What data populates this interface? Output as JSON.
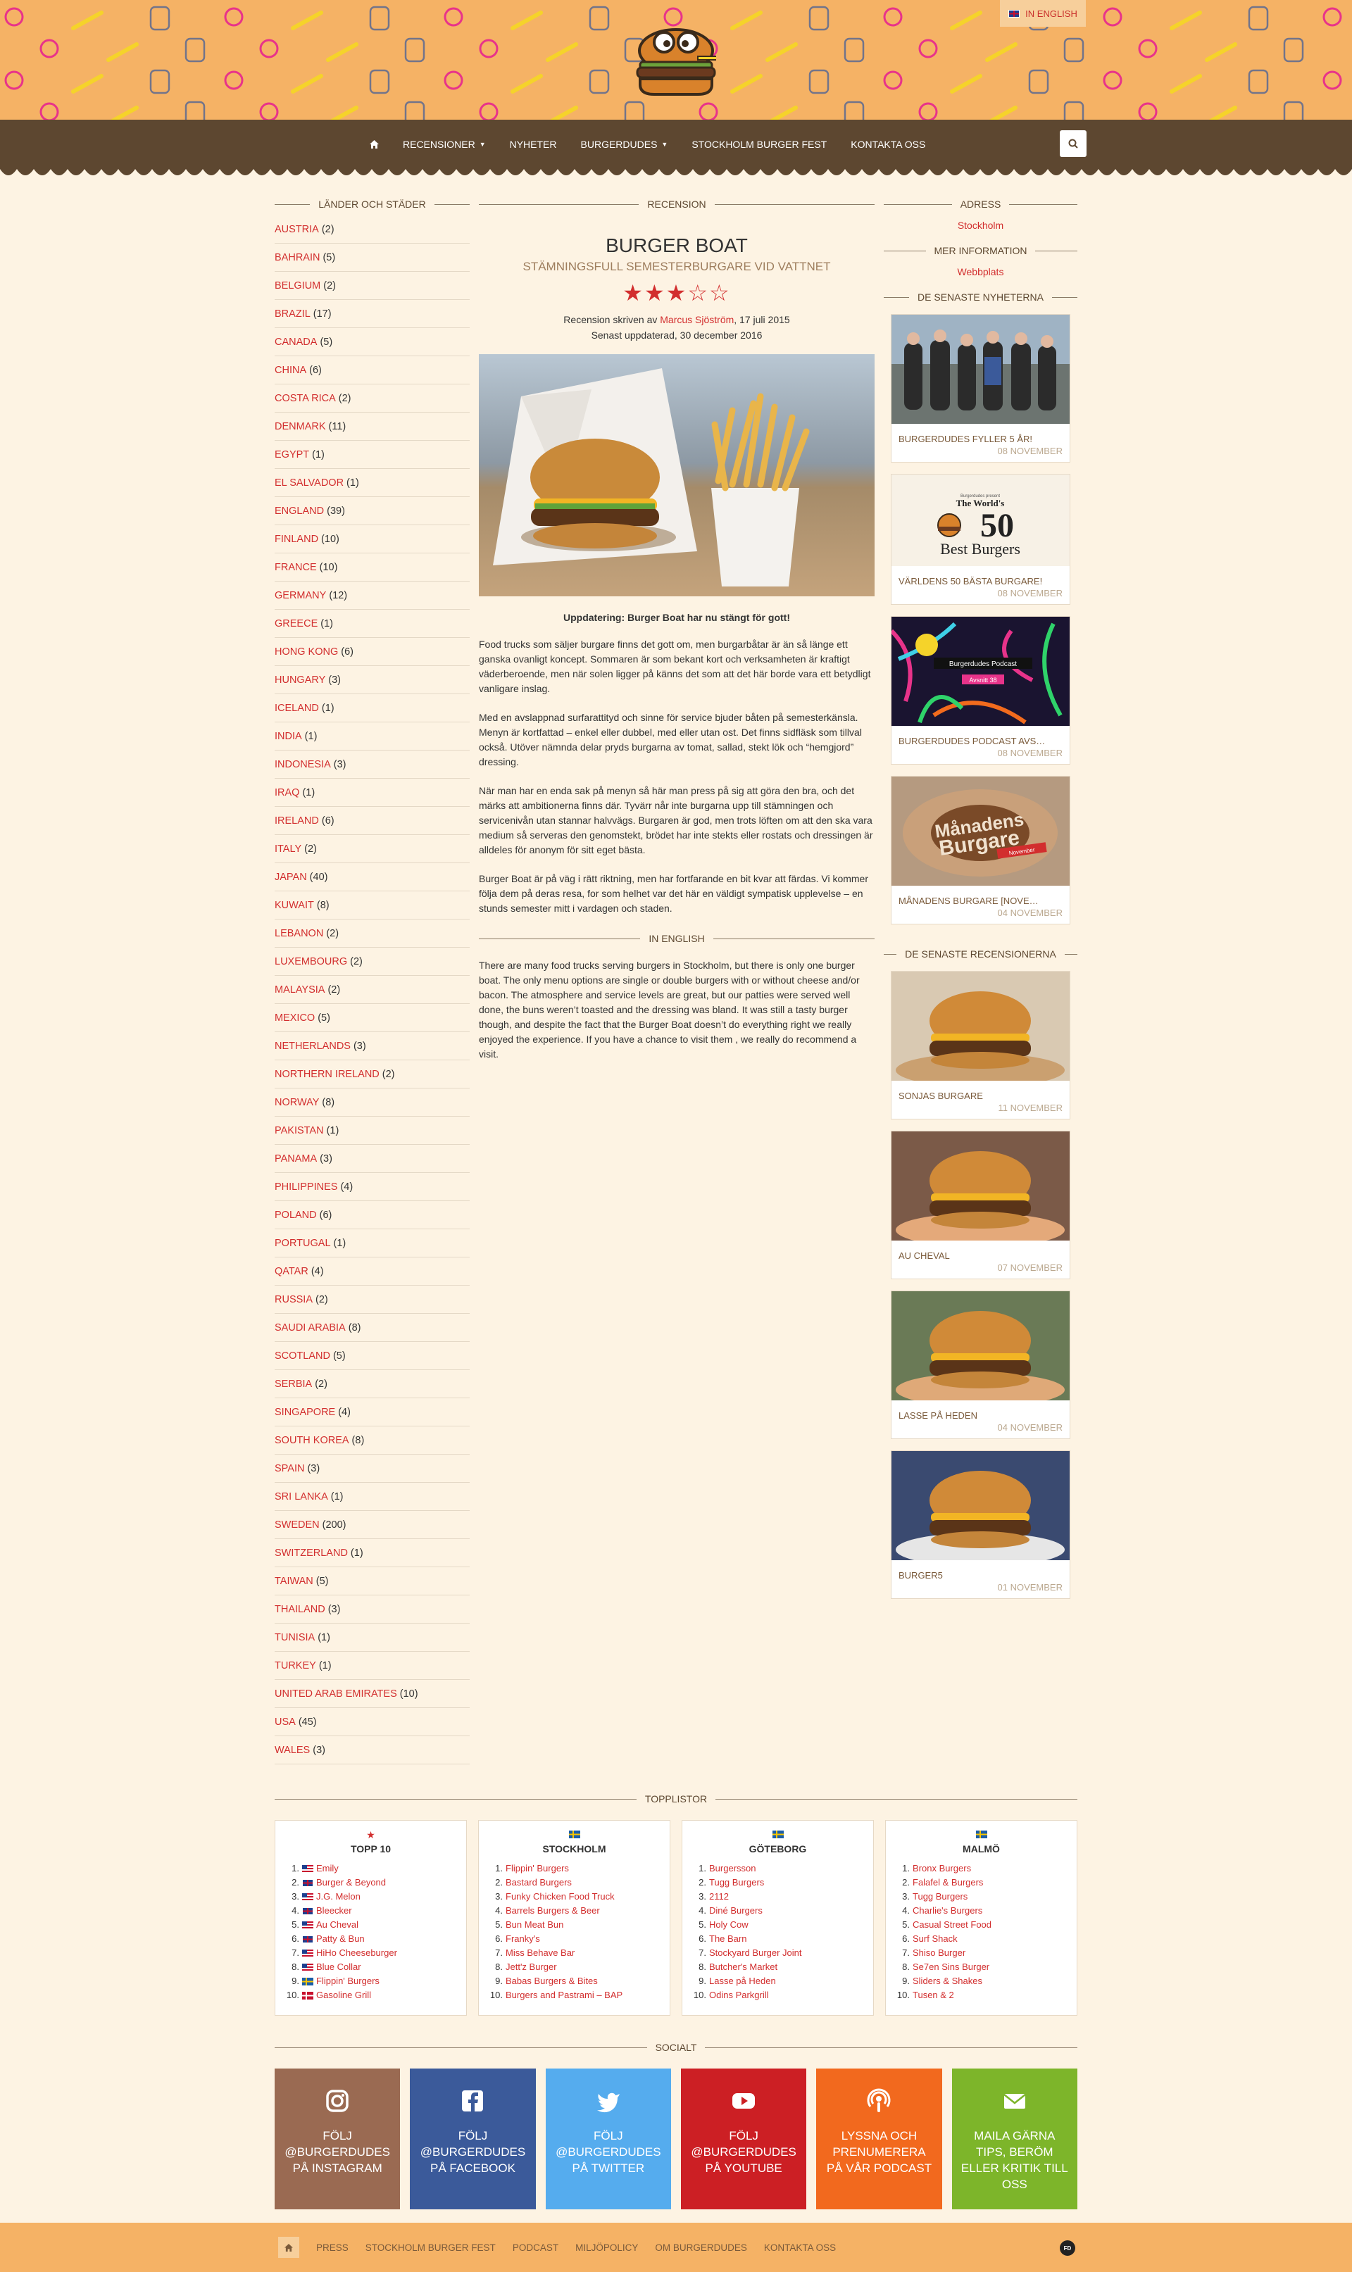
{
  "header": {
    "lang_label": "In English"
  },
  "nav": {
    "items": [
      "Recensioner",
      "Nyheter",
      "Burgerdudes",
      "Stockholm Burger Fest",
      "Kontakta oss"
    ]
  },
  "left": {
    "title": "Länder och städer",
    "countries": [
      {
        "name": "Austria",
        "count": "(2)"
      },
      {
        "name": "Bahrain",
        "count": "(5)"
      },
      {
        "name": "Belgium",
        "count": "(2)"
      },
      {
        "name": "Brazil",
        "count": "(17)"
      },
      {
        "name": "Canada",
        "count": "(5)"
      },
      {
        "name": "China",
        "count": "(6)"
      },
      {
        "name": "Costa Rica",
        "count": "(2)"
      },
      {
        "name": "Denmark",
        "count": "(11)"
      },
      {
        "name": "Egypt",
        "count": "(1)"
      },
      {
        "name": "El Salvador",
        "count": "(1)"
      },
      {
        "name": "England",
        "count": "(39)"
      },
      {
        "name": "Finland",
        "count": "(10)"
      },
      {
        "name": "France",
        "count": "(10)"
      },
      {
        "name": "Germany",
        "count": "(12)"
      },
      {
        "name": "Greece",
        "count": "(1)"
      },
      {
        "name": "Hong Kong",
        "count": "(6)"
      },
      {
        "name": "Hungary",
        "count": "(3)"
      },
      {
        "name": "Iceland",
        "count": "(1)"
      },
      {
        "name": "India",
        "count": "(1)"
      },
      {
        "name": "Indonesia",
        "count": "(3)"
      },
      {
        "name": "Iraq",
        "count": "(1)"
      },
      {
        "name": "Ireland",
        "count": "(6)"
      },
      {
        "name": "Italy",
        "count": "(2)"
      },
      {
        "name": "Japan",
        "count": "(40)"
      },
      {
        "name": "Kuwait",
        "count": "(8)"
      },
      {
        "name": "Lebanon",
        "count": "(2)"
      },
      {
        "name": "Luxembourg",
        "count": "(2)"
      },
      {
        "name": "Malaysia",
        "count": "(2)"
      },
      {
        "name": "Mexico",
        "count": "(5)"
      },
      {
        "name": "Netherlands",
        "count": "(3)"
      },
      {
        "name": "Northern Ireland",
        "count": "(2)"
      },
      {
        "name": "Norway",
        "count": "(8)"
      },
      {
        "name": "Pakistan",
        "count": "(1)"
      },
      {
        "name": "Panama",
        "count": "(3)"
      },
      {
        "name": "Philippines",
        "count": "(4)"
      },
      {
        "name": "Poland",
        "count": "(6)"
      },
      {
        "name": "Portugal",
        "count": "(1)"
      },
      {
        "name": "Qatar",
        "count": "(4)"
      },
      {
        "name": "Russia",
        "count": "(2)"
      },
      {
        "name": "Saudi Arabia",
        "count": "(8)"
      },
      {
        "name": "Scotland",
        "count": "(5)"
      },
      {
        "name": "Serbia",
        "count": "(2)"
      },
      {
        "name": "Singapore",
        "count": "(4)"
      },
      {
        "name": "South Korea",
        "count": "(8)"
      },
      {
        "name": "Spain",
        "count": "(3)"
      },
      {
        "name": "Sri Lanka",
        "count": "(1)"
      },
      {
        "name": "Sweden",
        "count": "(200)"
      },
      {
        "name": "Switzerland",
        "count": "(1)"
      },
      {
        "name": "Taiwan",
        "count": "(5)"
      },
      {
        "name": "Thailand",
        "count": "(3)"
      },
      {
        "name": "Tunisia",
        "count": "(1)"
      },
      {
        "name": "Turkey",
        "count": "(1)"
      },
      {
        "name": "United Arab Emirates",
        "count": "(10)"
      },
      {
        "name": "USA",
        "count": "(45)"
      },
      {
        "name": "Wales",
        "count": "(3)"
      }
    ]
  },
  "review": {
    "section_title": "Recension",
    "title": "Burger Boat",
    "subtitle": "Stämningsfull semesterburgare vid vattnet",
    "rating": 3,
    "max_rating": 5,
    "written_by_prefix": "Recension skriven av",
    "author": "Marcus Sjöström",
    "date_suffix": ", 17 juli 2015",
    "updated": "Senast uppdaterad, 30 december 2016",
    "update_note": "Uppdatering: Burger Boat har nu stängt för gott!",
    "paragraphs": [
      "Food trucks som säljer burgare finns det gott om, men burgarbåtar är än så länge ett ganska ovanligt koncept. Sommaren är som bekant kort och verksamheten är kraftigt väderberoende, men när solen ligger på känns det som att det här borde vara ett betydligt vanligare inslag.",
      "Med en avslappnad surfarattityd och sinne för service bjuder båten på semesterkänsla. Menyn är kortfattad – enkel eller dubbel, med eller utan ost. Det finns sidfläsk som tillval också. Utöver nämnda delar pryds burgarna av tomat, sallad, stekt lök och “hemgjord” dressing.",
      "När man har en enda sak på menyn så här man press på sig att göra den bra, och det märks att ambitionerna finns där. Tyvärr når inte burgarna upp till stämningen och servicenivån utan stannar halvvägs. Burgaren är god, men trots löften om att den ska vara medium så serveras den genomstekt, brödet har inte stekts eller rostats och dressingen är alldeles för anonym för sitt eget bästa.",
      "Burger Boat är på väg i rätt riktning, men har fortfarande en bit kvar att färdas. Vi kommer följa dem på deras resa, for som helhet var det här en väldigt sympatisk upplevelse – en stunds semester mitt i vardagen och staden."
    ],
    "english_title": "In English",
    "english_text": "There are many food trucks serving burgers in Stockholm, but there is only one burger boat. The only menu options are single or double burgers with or without cheese and/or bacon. The atmosphere and service levels are great, but our patties were served well done, the buns weren’t toasted and the dressing was bland. It was still a tasty burger though, and despite the fact that the Burger Boat doesn’t do everything right we really enjoyed the experience. If you have a chance to visit them , we really do recommend a visit."
  },
  "right": {
    "address_title": "Adress",
    "address": "Stockholm",
    "more_title": "Mer information",
    "more_link": "Webbplats",
    "news_title": "De senaste nyheterna",
    "news": [
      {
        "title": "Burgerdudes fyller 5 år!",
        "date": "08 November"
      },
      {
        "title": "Världens 50 bästa burgare!",
        "date": "08 November"
      },
      {
        "title": "Burgerdudes Podcast avs…",
        "date": "08 November"
      },
      {
        "title": "Månadens burgare [Nove…",
        "date": "04 November"
      }
    ],
    "best50": {
      "small": "Burgerdudes present",
      "line1": "The World's",
      "num": "50",
      "line2": "Best Burgers"
    },
    "podcast": {
      "label": "Burgerdudes Podcast",
      "episode": "Avsnitt 38"
    },
    "monthly": {
      "line1": "Månadens",
      "line2": "Burgare",
      "ribbon": "November"
    },
    "reviews_title": "De senaste recensionerna",
    "reviews": [
      {
        "title": "Sonjas burgare",
        "date": "11 November"
      },
      {
        "title": "Au Cheval",
        "date": "07 November"
      },
      {
        "title": "Lasse på Heden",
        "date": "04 November"
      },
      {
        "title": "Burger5",
        "date": "01 November"
      }
    ]
  },
  "toplists": {
    "title": "Topplistor",
    "lists": [
      {
        "title": "Topp 10",
        "items": [
          {
            "name": "Emily",
            "flag": "us"
          },
          {
            "name": "Burger & Beyond",
            "flag": "gb"
          },
          {
            "name": "J.G. Melon",
            "flag": "us"
          },
          {
            "name": "Bleecker",
            "flag": "gb"
          },
          {
            "name": "Au Cheval",
            "flag": "us"
          },
          {
            "name": "Patty & Bun",
            "flag": "gb"
          },
          {
            "name": "HiHo Cheeseburger",
            "flag": "us"
          },
          {
            "name": "Blue Collar",
            "flag": "us"
          },
          {
            "name": "Flippin' Burgers",
            "flag": "se"
          },
          {
            "name": "Gasoline Grill",
            "flag": "dk"
          }
        ]
      },
      {
        "title": "Stockholm",
        "items": [
          {
            "name": "Flippin' Burgers"
          },
          {
            "name": "Bastard Burgers"
          },
          {
            "name": "Funky Chicken Food Truck"
          },
          {
            "name": "Barrels Burgers & Beer"
          },
          {
            "name": "Bun Meat Bun"
          },
          {
            "name": "Franky's"
          },
          {
            "name": "Miss Behave Bar"
          },
          {
            "name": "Jett'z Burger"
          },
          {
            "name": "Babas Burgers & Bites"
          },
          {
            "name": "Burgers and Pastrami – BAP"
          }
        ]
      },
      {
        "title": "Göteborg",
        "items": [
          {
            "name": "Burgersson"
          },
          {
            "name": "Tugg Burgers"
          },
          {
            "name": "2112"
          },
          {
            "name": "Diné Burgers"
          },
          {
            "name": "Holy Cow"
          },
          {
            "name": "The Barn"
          },
          {
            "name": "Stockyard Burger Joint"
          },
          {
            "name": "Butcher's Market"
          },
          {
            "name": "Lasse på Heden"
          },
          {
            "name": "Odins Parkgrill"
          }
        ]
      },
      {
        "title": "Malmö",
        "items": [
          {
            "name": "Bronx Burgers"
          },
          {
            "name": "Falafel & Burgers"
          },
          {
            "name": "Tugg Burgers"
          },
          {
            "name": "Charlie's Burgers"
          },
          {
            "name": "Casual Street Food"
          },
          {
            "name": "Surf Shack"
          },
          {
            "name": "Shiso Burger"
          },
          {
            "name": "Se7en Sins Burger"
          },
          {
            "name": "Sliders & Shakes"
          },
          {
            "name": "Tusen & 2"
          }
        ]
      }
    ]
  },
  "social": {
    "title": "Socialt",
    "tiles": [
      {
        "label": "Följ @burgerdudes på Instagram",
        "color": "#9a6a52",
        "icon": "instagram-icon"
      },
      {
        "label": "Följ @burgerdudes på Facebook",
        "color": "#3b5a9a",
        "icon": "facebook-icon"
      },
      {
        "label": "Följ @burgerdudes på Twitter",
        "color": "#55acee",
        "icon": "twitter-icon"
      },
      {
        "label": "Följ @burgerdudes på YouTube",
        "color": "#cc1f24",
        "icon": "youtube-icon"
      },
      {
        "label": "Lyssna och prenumerera på vår podcast",
        "color": "#f2691e",
        "icon": "podcast-icon"
      },
      {
        "label": "Maila gärna tips, beröm eller kritik till oss",
        "color": "#7db52a",
        "icon": "mail-icon"
      }
    ]
  },
  "footer": {
    "items": [
      "Press",
      "Stockholm Burger Fest",
      "Podcast",
      "Miljöpolicy",
      "Om Burgerdudes",
      "Kontakta oss"
    ],
    "badge": "FD"
  }
}
